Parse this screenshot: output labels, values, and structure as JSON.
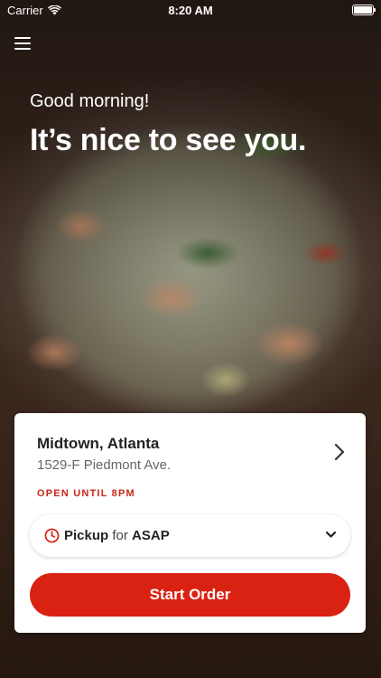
{
  "status_bar": {
    "carrier": "Carrier",
    "time": "8:20 AM",
    "battery_level": 1.0
  },
  "header": {
    "menu_icon": "hamburger-menu-icon"
  },
  "hero": {
    "greeting": "Good morning!",
    "headline": "It’s nice to see you."
  },
  "location": {
    "name": "Midtown, Atlanta",
    "address": "1529-F Piedmont Ave.",
    "hours_status": "OPEN UNTIL 8PM",
    "chevron_icon": "chevron-right-icon"
  },
  "order_type": {
    "mode": "Pickup",
    "connector": "for",
    "time": "ASAP",
    "clock_icon": "clock-icon",
    "dropdown_icon": "chevron-down-icon"
  },
  "actions": {
    "start_order_label": "Start Order"
  },
  "colors": {
    "accent": "#d92211",
    "status_red": "#c9261a"
  }
}
